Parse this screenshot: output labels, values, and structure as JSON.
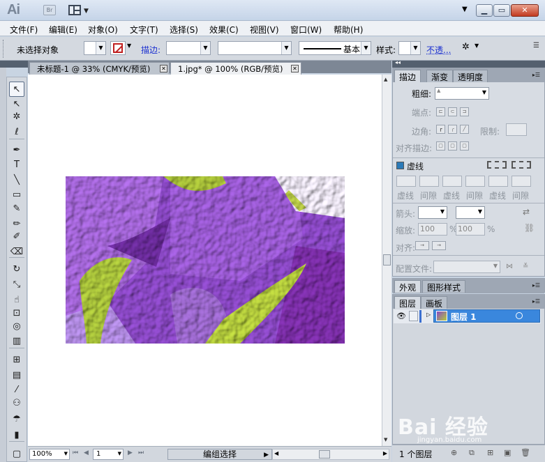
{
  "app": {
    "logo_text": "Ai",
    "bridge_label": "Br",
    "window_controls": [
      "▁",
      "▭",
      "✕"
    ]
  },
  "menu": [
    "文件(F)",
    "编辑(E)",
    "对象(O)",
    "文字(T)",
    "选择(S)",
    "效果(C)",
    "视图(V)",
    "窗口(W)",
    "帮助(H)"
  ],
  "control_bar": {
    "selection_status": "未选择对象",
    "stroke_label": "描边:",
    "profile_value": "基本",
    "style_label": "样式:",
    "opacity_label": "不透..."
  },
  "tabs": [
    {
      "label": "未标题-1 @ 33% (CMYK/预览)",
      "active": false
    },
    {
      "label": "1.jpg* @ 100% (RGB/预览)",
      "active": true
    }
  ],
  "tools": [
    {
      "name": "selection-tool",
      "glyph": "↖"
    },
    {
      "name": "direct-selection-tool",
      "glyph": "↖"
    },
    {
      "name": "magic-wand-tool",
      "glyph": "✲"
    },
    {
      "name": "lasso-tool",
      "glyph": "ℓ"
    },
    {
      "name": "pen-tool",
      "glyph": "✒"
    },
    {
      "name": "type-tool",
      "glyph": "T"
    },
    {
      "name": "line-tool",
      "glyph": "╲"
    },
    {
      "name": "rectangle-tool",
      "glyph": "▭"
    },
    {
      "name": "paintbrush-tool",
      "glyph": "✎"
    },
    {
      "name": "pencil-tool",
      "glyph": "✏"
    },
    {
      "name": "blob-brush-tool",
      "glyph": "✐"
    },
    {
      "name": "eraser-tool",
      "glyph": "⌫"
    },
    {
      "name": "rotate-tool",
      "glyph": "↻"
    },
    {
      "name": "scale-tool",
      "glyph": "⤡"
    },
    {
      "name": "warp-tool",
      "glyph": "☝"
    },
    {
      "name": "free-transform-tool",
      "glyph": "⊡"
    },
    {
      "name": "shape-builder-tool",
      "glyph": "◎"
    },
    {
      "name": "graph-tool",
      "glyph": "▥"
    },
    {
      "name": "mesh-tool",
      "glyph": "⊞"
    },
    {
      "name": "gradient-tool",
      "glyph": "▤"
    },
    {
      "name": "eyedropper-tool",
      "glyph": "⁄"
    },
    {
      "name": "blend-tool",
      "glyph": "⚇"
    },
    {
      "name": "symbol-sprayer-tool",
      "glyph": "☂"
    },
    {
      "name": "column-graph-tool",
      "glyph": "▮"
    },
    {
      "name": "artboard-tool",
      "glyph": "▢"
    }
  ],
  "status": {
    "zoom": "100%",
    "page": "1",
    "selection_mode": "编组选择"
  },
  "stroke_panel": {
    "tabs": [
      "描边",
      "渐变",
      "透明度"
    ],
    "weight_label": "粗细:",
    "cap_label": "端点:",
    "corner_label": "边角:",
    "limit_label": "限制:",
    "align_label": "对齐描边:",
    "dashed_label": "虚线",
    "dash_labels": [
      "虚线",
      "间隙",
      "虚线",
      "间隙",
      "虚线",
      "间隙"
    ],
    "arrowhead_label": "箭头:",
    "scale_label": "缩放:",
    "scale_values": [
      "100",
      "100"
    ],
    "percent_symbol": "%",
    "align_arrow_label": "对齐:",
    "profile_label": "配置文件:"
  },
  "appearance_panel": {
    "tabs": [
      "外观",
      "图形样式"
    ]
  },
  "layers_panel": {
    "tabs": [
      "图层",
      "画板"
    ],
    "layers": [
      {
        "name": "图层 1",
        "selected": true
      }
    ],
    "footer_count": "1 个图层"
  },
  "watermark": {
    "brand": "Bai 经验",
    "url": "jingyan.baidu.com"
  }
}
